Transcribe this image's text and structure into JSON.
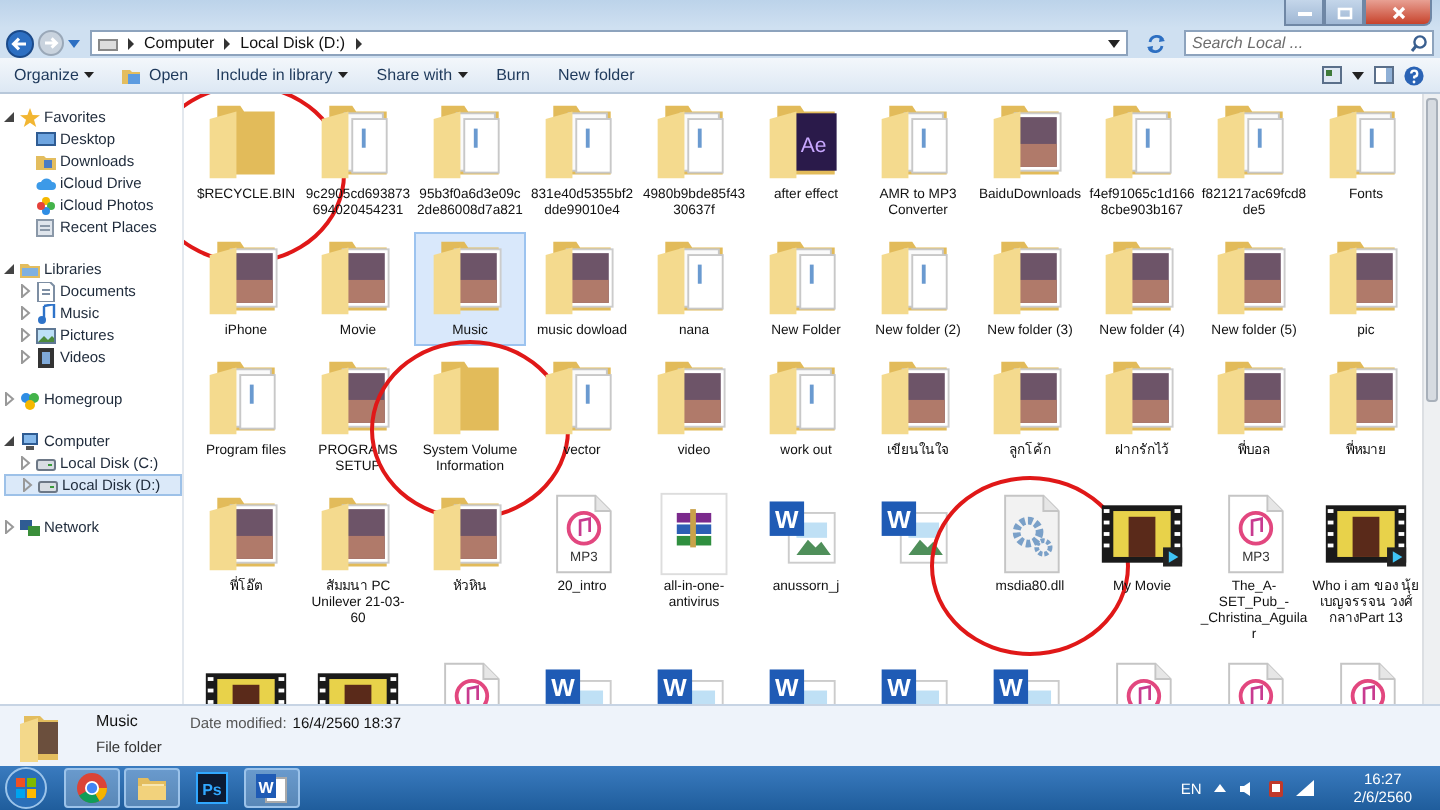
{
  "address": {
    "breadcrumbs": [
      "Computer",
      "Local Disk (D:)"
    ],
    "search": {
      "placeholder": "Search Local ..."
    }
  },
  "toolbar": {
    "buttons": [
      {
        "label": "Organize",
        "dropdown": true,
        "kind": "plain"
      },
      {
        "label": "Open",
        "dropdown": false,
        "kind": "open"
      },
      {
        "label": "Include in library",
        "dropdown": true,
        "kind": "plain"
      },
      {
        "label": "Share with",
        "dropdown": true,
        "kind": "plain"
      },
      {
        "label": "Burn",
        "dropdown": false,
        "kind": "plain"
      },
      {
        "label": "New folder",
        "dropdown": false,
        "kind": "plain"
      }
    ]
  },
  "sidebar": {
    "items": [
      {
        "label": "Favorites",
        "kind": "star",
        "expanded": true,
        "selected": false,
        "children": [
          {
            "label": "Desktop",
            "kind": "desktop",
            "selected": false
          },
          {
            "label": "Downloads",
            "kind": "folder",
            "selected": false
          },
          {
            "label": "iCloud Drive",
            "kind": "cloud",
            "selected": false
          },
          {
            "label": "iCloud Photos",
            "kind": "photos",
            "selected": false
          },
          {
            "label": "Recent Places",
            "kind": "recent",
            "selected": false
          }
        ]
      },
      {
        "label": "Libraries",
        "kind": "library",
        "expanded": true,
        "selected": false,
        "children": [
          {
            "label": "Documents",
            "kind": "document",
            "expanded": false,
            "selected": false
          },
          {
            "label": "Music",
            "kind": "music",
            "expanded": false,
            "selected": false
          },
          {
            "label": "Pictures",
            "kind": "pictures",
            "expanded": false,
            "selected": false
          },
          {
            "label": "Videos",
            "kind": "videos",
            "expanded": false,
            "selected": false
          }
        ]
      },
      {
        "label": "Homegroup",
        "kind": "homegroup",
        "expanded": false,
        "selected": false
      },
      {
        "label": "Computer",
        "kind": "computer",
        "expanded": true,
        "selected": false,
        "children": [
          {
            "label": "Local Disk (C:)",
            "kind": "drive",
            "expanded": false,
            "selected": false
          },
          {
            "label": "Local Disk (D:)",
            "kind": "drive",
            "expanded": false,
            "selected": true
          }
        ]
      },
      {
        "label": "Network",
        "kind": "network",
        "expanded": false,
        "selected": false
      }
    ]
  },
  "files": [
    {
      "kind": "folder",
      "label": "$RECYCLE.BIN",
      "selected": false,
      "circled": true
    },
    {
      "kind": "paperfolder",
      "label": "9c2905cd693873694020454231",
      "selected": false,
      "circled": false
    },
    {
      "kind": "paperfolder",
      "label": "95b3f0a6d3e09c2de86008d7a821",
      "selected": false,
      "circled": false
    },
    {
      "kind": "paperfolder",
      "label": "831e40d5355bf2dde99010e4",
      "selected": false,
      "circled": false
    },
    {
      "kind": "paperfolder",
      "label": "4980b9bde85f4330637f",
      "selected": false,
      "circled": false
    },
    {
      "kind": "logofolder",
      "badge": "Ae",
      "label": "after effect",
      "selected": false,
      "circled": false
    },
    {
      "kind": "paperfolder",
      "label": "AMR to MP3 Converter",
      "selected": false,
      "circled": false
    },
    {
      "kind": "photofolder",
      "label": "BaiduDownloads",
      "selected": false,
      "circled": false
    },
    {
      "kind": "paperfolder",
      "label": "f4ef91065c1d1668cbe903b167",
      "selected": false,
      "circled": false
    },
    {
      "kind": "paperfolder",
      "label": "f821217ac69fcd8de5",
      "selected": false,
      "circled": false
    },
    {
      "kind": "paperfolder",
      "label": "Fonts",
      "selected": false,
      "circled": false
    },
    {
      "kind": "photofolder",
      "label": "iPhone",
      "selected": false,
      "circled": false
    },
    {
      "kind": "photofolder",
      "label": "Movie",
      "selected": false,
      "circled": false
    },
    {
      "kind": "photofolder",
      "label": "Music",
      "selected": true,
      "circled": false
    },
    {
      "kind": "photofolder",
      "label": "music dowload",
      "selected": false,
      "circled": false
    },
    {
      "kind": "paperfolder",
      "label": "nana",
      "selected": false,
      "circled": false
    },
    {
      "kind": "paperfolder",
      "label": "New Folder",
      "selected": false,
      "circled": false
    },
    {
      "kind": "paperfolder",
      "label": "New folder (2)",
      "selected": false,
      "circled": false
    },
    {
      "kind": "photofolder",
      "label": "New folder (3)",
      "selected": false,
      "circled": false
    },
    {
      "kind": "photofolder",
      "label": "New folder (4)",
      "selected": false,
      "circled": false
    },
    {
      "kind": "photofolder",
      "label": "New folder (5)",
      "selected": false,
      "circled": false
    },
    {
      "kind": "photofolder",
      "label": "pic",
      "selected": false,
      "circled": false
    },
    {
      "kind": "paperfolder",
      "label": "Program files",
      "selected": false,
      "circled": false
    },
    {
      "kind": "photofolder",
      "label": "PROGRAMS SETUP",
      "selected": false,
      "circled": false
    },
    {
      "kind": "folder",
      "label": "System Volume Information",
      "selected": false,
      "circled": true
    },
    {
      "kind": "paperfolder",
      "label": "vector",
      "selected": false,
      "circled": false
    },
    {
      "kind": "photofolder",
      "label": "video",
      "selected": false,
      "circled": false
    },
    {
      "kind": "paperfolder",
      "label": "work out",
      "selected": false,
      "circled": false
    },
    {
      "kind": "photofolder",
      "label": "เขียนในใจ",
      "selected": false,
      "circled": false
    },
    {
      "kind": "photofolder",
      "label": "ลูกโค้ก",
      "selected": false,
      "circled": false
    },
    {
      "kind": "photofolder",
      "label": "ฝากรักไว้",
      "selected": false,
      "circled": false
    },
    {
      "kind": "photofolder",
      "label": "พี่บอล",
      "selected": false,
      "circled": false
    },
    {
      "kind": "photofolder",
      "label": "พี่หมาย",
      "selected": false,
      "circled": false
    },
    {
      "kind": "photofolder",
      "label": "พี่โอ๊ต",
      "selected": false,
      "circled": false
    },
    {
      "kind": "photofolder",
      "label": "สัมมนา PC Unilever 21-03-60",
      "selected": false,
      "circled": false
    },
    {
      "kind": "photofolder",
      "label": "หัวหิน",
      "selected": false,
      "circled": false
    },
    {
      "kind": "mp3",
      "badge": "MP3",
      "label": "20_intro",
      "selected": false,
      "circled": false
    },
    {
      "kind": "archive",
      "label": "all-in-one-antivirus",
      "selected": false,
      "circled": false
    },
    {
      "kind": "word",
      "badge": "W",
      "label": "anussorn_j",
      "selected": false,
      "circled": false
    },
    {
      "kind": "word",
      "badge": "W",
      "selected": false,
      "circled": false
    },
    {
      "kind": "dll",
      "label": "msdia80.dll",
      "selected": false,
      "circled": true
    },
    {
      "kind": "video",
      "label": "My Movie",
      "selected": false,
      "circled": false
    },
    {
      "kind": "mp3",
      "badge": "MP3",
      "label": "The_A-SET_Pub_-_Christina_Aguilar",
      "selected": false,
      "circled": false
    },
    {
      "kind": "video",
      "label": "Who i am ของ นุ้ย เบญจรรจน วงศ์กลางPart 13",
      "selected": false,
      "circled": false
    },
    {
      "kind": "video",
      "selected": false,
      "circled": false
    },
    {
      "kind": "video",
      "selected": false,
      "circled": false
    },
    {
      "kind": "mp3",
      "selected": false,
      "circled": false
    },
    {
      "kind": "word",
      "badge": "W",
      "selected": false,
      "circled": false
    },
    {
      "kind": "word",
      "badge": "W",
      "selected": false,
      "circled": false
    },
    {
      "kind": "word",
      "badge": "W",
      "selected": false,
      "circled": false
    },
    {
      "kind": "word",
      "badge": "W",
      "selected": false,
      "circled": false
    },
    {
      "kind": "word",
      "badge": "W",
      "selected": false,
      "circled": false
    },
    {
      "kind": "mp3",
      "selected": false,
      "circled": false
    },
    {
      "kind": "mp3",
      "selected": false,
      "circled": false
    },
    {
      "kind": "mp3",
      "selected": false,
      "circled": false
    }
  ],
  "details": {
    "name": "Music",
    "date_label": "Date modified:",
    "date": "16/4/2560 18:37",
    "type": "File folder"
  },
  "taskbar": {
    "apps": [
      {
        "kind": "chrome",
        "open": true
      },
      {
        "kind": "explorer",
        "open": true
      },
      {
        "kind": "photoshop",
        "badge": "Ps",
        "open": false
      },
      {
        "kind": "word",
        "badge": "W",
        "open": true
      }
    ],
    "language": "EN",
    "time": "16:27",
    "date": "2/6/2560"
  }
}
